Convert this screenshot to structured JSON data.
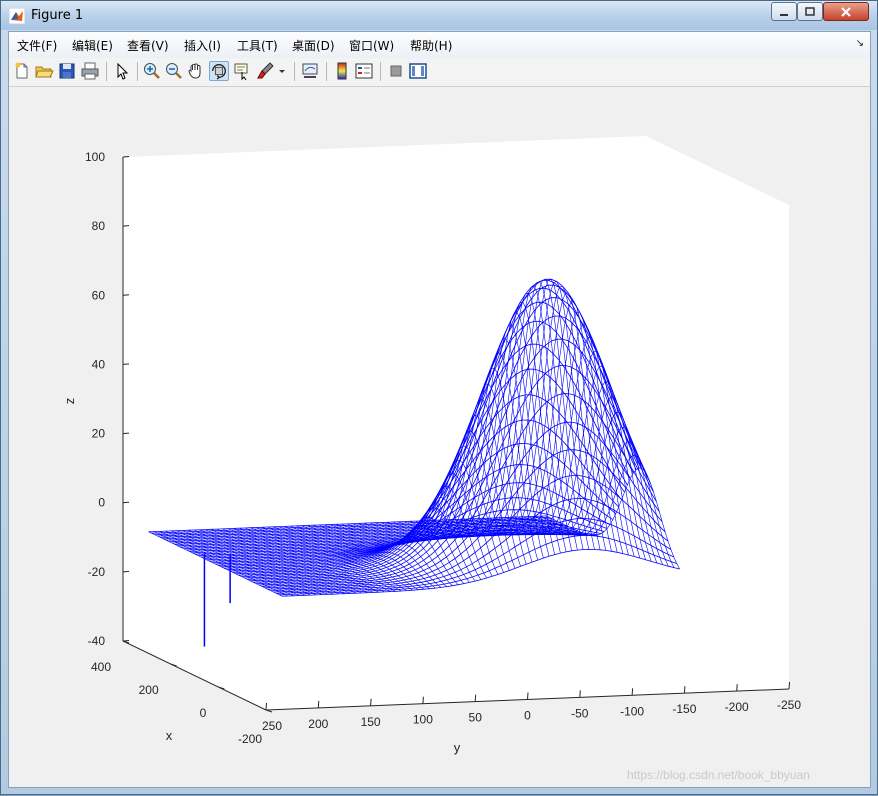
{
  "window": {
    "title": "Figure 1"
  },
  "menu": [
    "文件(F)",
    "编辑(E)",
    "查看(V)",
    "插入(I)",
    "工具(T)",
    "桌面(D)",
    "窗口(W)",
    "帮助(H)"
  ],
  "toolbar": [
    "new-figure-icon",
    "open-file-icon",
    "save-icon",
    "print-icon",
    "select-arrow-icon",
    "zoom-in-icon",
    "zoom-out-icon",
    "pan-hand-icon",
    "rotate-3d-icon",
    "data-cursor-icon",
    "brush-icon",
    "link-plot-icon",
    "colorbar-icon",
    "legend-icon",
    "hide-plot-tools-icon",
    "show-plot-tools-icon"
  ],
  "chart_data": {
    "type": "surface",
    "style": "mesh",
    "color": "#0000ff",
    "xlabel": "x",
    "ylabel": "y",
    "zlabel": "z",
    "xlim": [
      -200,
      400
    ],
    "ylim": [
      -250,
      250
    ],
    "zlim": [
      -40,
      100
    ],
    "x_ticks": [
      "-200",
      "0",
      "200",
      "400"
    ],
    "y_ticks": [
      "250",
      "200",
      "150",
      "100",
      "50",
      "0",
      "-50",
      "-100",
      "-150",
      "-200",
      "-250"
    ],
    "z_ticks": [
      "-40",
      "-20",
      "0",
      "20",
      "40",
      "60",
      "80",
      "100"
    ],
    "peak": {
      "z": 75
    },
    "grid": false
  },
  "watermark": "https://blog.csdn.net/book_bbyuan"
}
